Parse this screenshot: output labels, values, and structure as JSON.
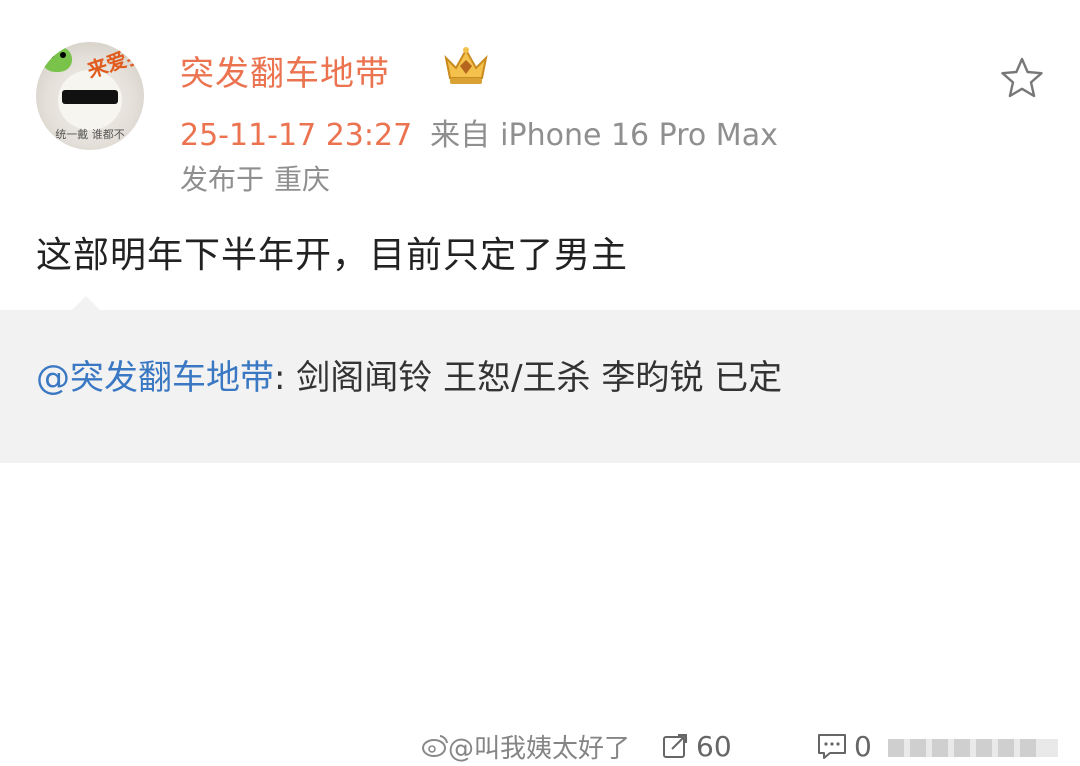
{
  "post": {
    "username": "突发翻车地带",
    "time": "25-11-17 23:27",
    "source_prefix": "来自",
    "device": "iPhone 16 Pro Max",
    "location_prefix": "发布于",
    "location": "重庆",
    "content": "这部明年下半年开，目前只定了男主",
    "avatar_tag": "来爱我",
    "avatar_caption": "统一戴 谁都不"
  },
  "repost": {
    "mention": "@突发翻车地带",
    "text": ": 剑阁闻铃 王恕/王杀 李昀锐 已定"
  },
  "actions": {
    "watermark": "@叫我姨太好了",
    "repost_count": "60",
    "comment_count": "0"
  },
  "colors": {
    "accent": "#eb7350",
    "link": "#3a78c3",
    "repost_bg": "#f2f2f2"
  },
  "icons": {
    "favorite": "star-outline-icon",
    "vip": "crown-badge-icon",
    "repost": "repost-arrow-icon",
    "comment": "comment-bubble-icon",
    "like": "thumbs-up-icon"
  }
}
